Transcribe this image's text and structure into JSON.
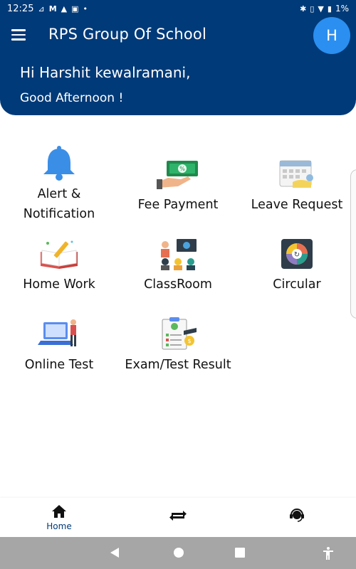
{
  "status_bar": {
    "time": "12:25",
    "battery": "1%"
  },
  "header": {
    "title": "RPS Group Of School",
    "avatar_letter": "H",
    "greeting": "Hi Harshit kewalramani,",
    "subgreeting": "Good Afternoon !"
  },
  "tiles": [
    {
      "label_line1": "Alert &",
      "label_line2": "Notification",
      "icon": "bell-icon"
    },
    {
      "label": "Fee Payment",
      "icon": "fee-payment-icon"
    },
    {
      "label": "Leave Request",
      "icon": "calendar-icon"
    },
    {
      "label": "Home Work",
      "icon": "homework-book-icon"
    },
    {
      "label": "ClassRoom",
      "icon": "classroom-icon"
    },
    {
      "label": "Circular",
      "icon": "circular-icon"
    },
    {
      "label": "Online Test",
      "icon": "online-test-icon"
    },
    {
      "label": "Exam/Test Result",
      "icon": "exam-result-icon"
    }
  ],
  "bottom_nav": {
    "home_label": "Home"
  },
  "colors": {
    "primary": "#003a78",
    "avatar": "#2a8ff0",
    "sysbar": "#a6a6a6"
  }
}
